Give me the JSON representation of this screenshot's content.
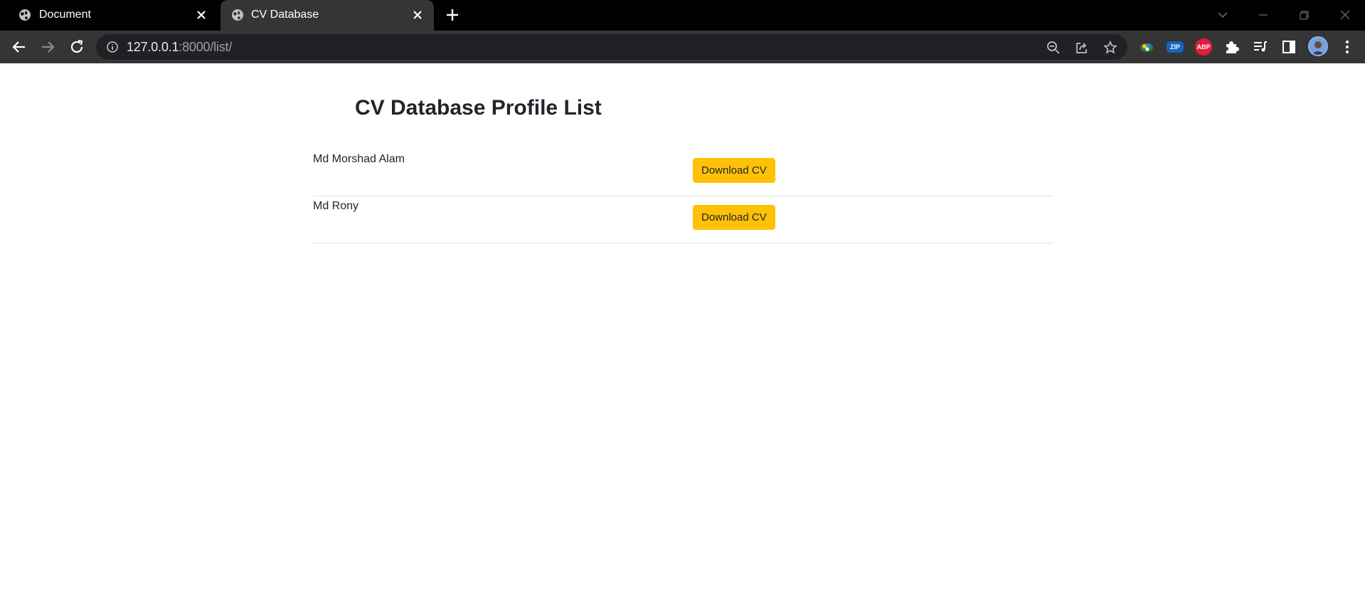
{
  "browser": {
    "tabs": [
      {
        "title": "Document",
        "active": false
      },
      {
        "title": "CV Database",
        "active": true
      }
    ],
    "address": {
      "host": "127.0.0.1",
      "path": ":8000/list/"
    },
    "colors": {
      "tabstrip": "#000000",
      "toolbar": "#353535",
      "omnibox": "#202124"
    },
    "extensions": [
      "zoom-icon",
      "share-icon",
      "star-icon",
      "color-extension-icon",
      "zip-extension-icon",
      "adblock-extension-icon",
      "extensions-puzzle-icon",
      "reading-list-icon",
      "side-panel-icon"
    ],
    "extension_labels": {
      "zip": "ZIP",
      "abp": "ABP"
    }
  },
  "page": {
    "heading": "CV Database Profile List",
    "profiles": [
      {
        "name": "Md Morshad Alam",
        "button": "Download CV"
      },
      {
        "name": "Md Rony",
        "button": "Download CV"
      }
    ],
    "button_color": "#ffc107"
  }
}
